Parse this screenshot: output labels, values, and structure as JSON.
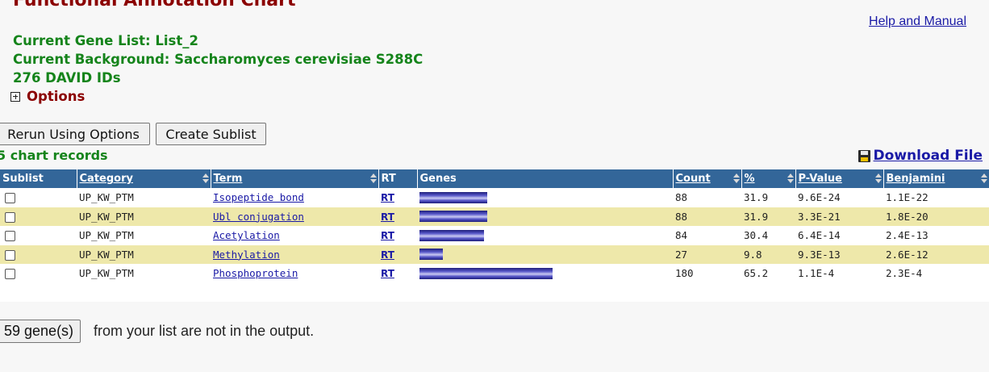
{
  "page": {
    "title": "Functional Annotation Chart",
    "help_link": "Help and Manual",
    "gene_list": "Current Gene List: List_2",
    "background": "Current Background: Saccharomyces cerevisiae S288C",
    "david_ids": "276 DAVID IDs",
    "options_label": "Options"
  },
  "buttons": {
    "rerun": "Rerun Using Options",
    "sublist": "Create Sublist"
  },
  "records_label": "5 chart records",
  "download_label": "Download File",
  "table": {
    "headers": {
      "sublist": "Sublist",
      "category": "Category",
      "term": "Term",
      "rt": "RT",
      "genes": "Genes",
      "count": "Count",
      "percent": "%",
      "pvalue": "P-Value",
      "benjamini": "Benjamini"
    },
    "rows": [
      {
        "category": "UP_KW_PTM",
        "term": "Isopeptide bond",
        "rt": "RT",
        "count": "88",
        "percent": "31.9",
        "pvalue": "9.6E-24",
        "benjamini": "1.1E-22"
      },
      {
        "category": "UP_KW_PTM",
        "term": "Ubl conjugation",
        "rt": "RT",
        "count": "88",
        "percent": "31.9",
        "pvalue": "3.3E-21",
        "benjamini": "1.8E-20"
      },
      {
        "category": "UP_KW_PTM",
        "term": "Acetylation",
        "rt": "RT",
        "count": "84",
        "percent": "30.4",
        "pvalue": "6.4E-14",
        "benjamini": "2.4E-13"
      },
      {
        "category": "UP_KW_PTM",
        "term": "Methylation",
        "rt": "RT",
        "count": "27",
        "percent": "9.8",
        "pvalue": "9.3E-13",
        "benjamini": "2.6E-12"
      },
      {
        "category": "UP_KW_PTM",
        "term": "Phosphoprotein",
        "rt": "RT",
        "count": "180",
        "percent": "65.2",
        "pvalue": "1.1E-4",
        "benjamini": "2.3E-4"
      }
    ]
  },
  "not_in_output": {
    "button": "59 gene(s)",
    "text": "from your list are not in the output."
  },
  "colors": {
    "header_bg": "#336699",
    "alt_row": "#eee8aa",
    "title": "#8b0000",
    "info_green": "#15841b",
    "link_blue": "#1a1aa6"
  }
}
